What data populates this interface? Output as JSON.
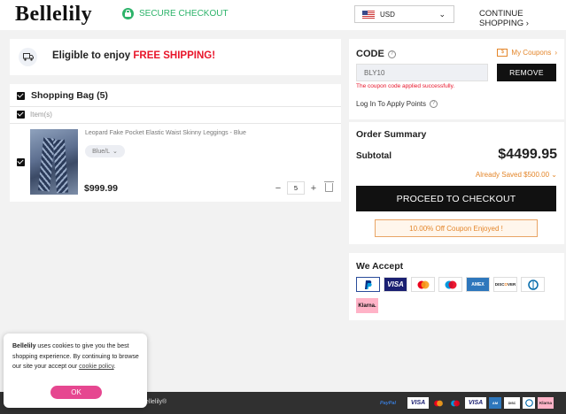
{
  "header": {
    "logo": "Bellelily",
    "secure_label": "SECURE CHECKOUT",
    "currency": "USD",
    "continue_label": "CONTINUE SHOPPING",
    "continue_arrow": "›"
  },
  "shipping_banner": {
    "text": "Eligible to enjoy ",
    "highlight": "FREE SHIPPING!"
  },
  "bag": {
    "title": "Shopping Bag (5)",
    "items_label": "Item(s)",
    "product": {
      "name": "Leopard Fake Pocket Elastic Waist Skinny Leggings - Blue",
      "variant": "Blue/L",
      "price": "$999.99",
      "quantity": "5",
      "minus": "−",
      "plus": "+"
    }
  },
  "coupon": {
    "title": "CODE",
    "my_coupons": "My Coupons",
    "my_coupons_arrow": "›",
    "code_value": "BLY10",
    "remove_label": "REMOVE",
    "success_message": "The coupon code applied successfully.",
    "login_points": "Log In To Apply Points"
  },
  "summary": {
    "title": "Order Summary",
    "subtotal_label": "Subtotal",
    "subtotal_value": "$4499.95",
    "saved": "Already Saved $500.00",
    "checkout_label": "PROCEED TO CHECKOUT",
    "coupon_enjoyed": "10.00% Off Coupon Enjoyed !"
  },
  "accept": {
    "title": "We Accept",
    "methods": [
      "PayPal",
      "VISA",
      "MC",
      "Maestro",
      "AMEX",
      "DISCOVER",
      "Diners",
      "Klarna."
    ]
  },
  "footer": {
    "copyright": "ellelily®",
    "methods": [
      "PayPal",
      "VISA",
      "MC",
      "MC",
      "VISA",
      "AMEX",
      "DISC",
      "Diners",
      "Klarna"
    ]
  },
  "cookie": {
    "brand": "Bellelily",
    "text": " uses cookies to give you the best shopping experience. By continuing to browse our site your accept our ",
    "link": "cookie policy",
    "period": ".",
    "ok_label": "OK"
  },
  "colors": {
    "secure_green": "#2db36a",
    "free_shipping_red": "#e8152a",
    "accent_orange": "#e4862a",
    "cookie_ok_pink": "#e64790",
    "primary_black": "#111111"
  }
}
